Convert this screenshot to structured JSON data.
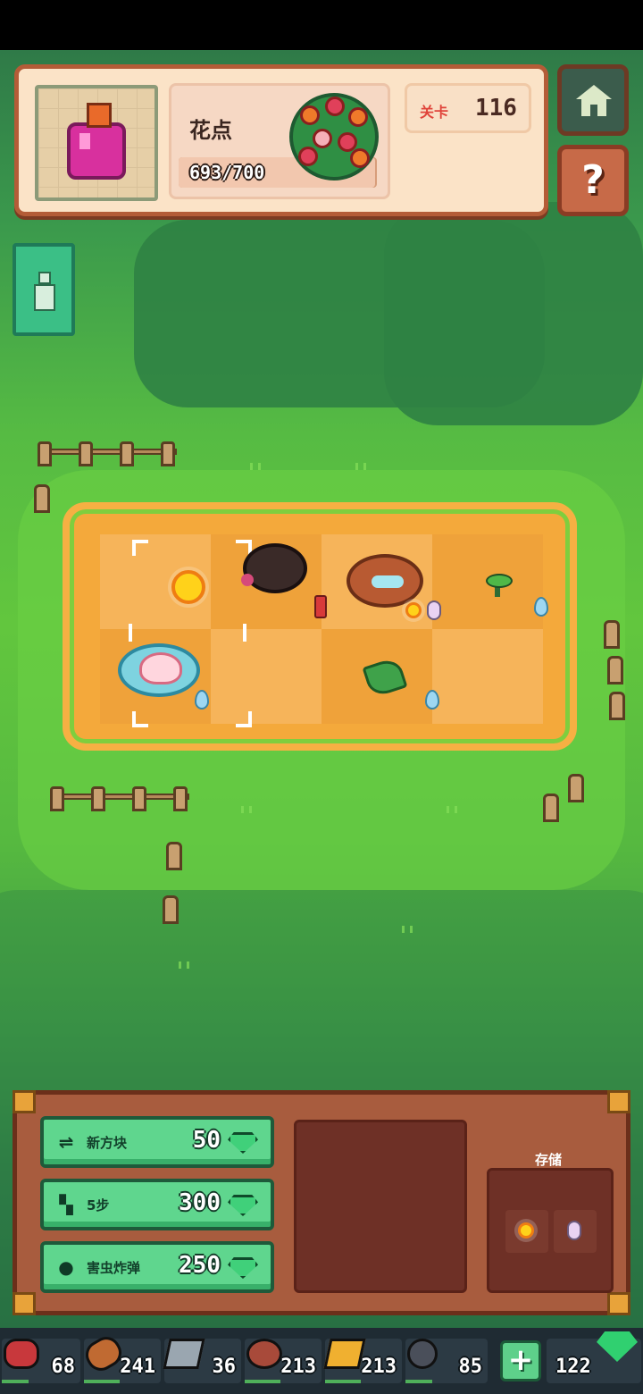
{
  "top_panel": {
    "flower_title": "花点",
    "progress_text": "693/700",
    "progress_value": 693,
    "progress_max": 700,
    "level_label": "关卡",
    "level_value": "116"
  },
  "buttons": {
    "home_icon": "home-icon",
    "help_label": "?"
  },
  "shop": {
    "items": [
      {
        "label": "新方块",
        "price": "50",
        "icon": "swap-icon"
      },
      {
        "label": "5步",
        "price": "300",
        "icon": "steps-icon"
      },
      {
        "label": "害虫炸弹",
        "price": "250",
        "icon": "bomb-icon"
      }
    ],
    "storage_label": "存储"
  },
  "resources": [
    {
      "name": "meat",
      "value": "68"
    },
    {
      "name": "wood",
      "value": "241"
    },
    {
      "name": "iron",
      "value": "36"
    },
    {
      "name": "fiber",
      "value": "213"
    },
    {
      "name": "gold",
      "value": "213"
    },
    {
      "name": "coal",
      "value": "85"
    },
    {
      "name": "gem",
      "value": "122"
    }
  ],
  "plus_label": "+",
  "colors": {
    "panel_border": "#b45c37",
    "board": "#f4a93b",
    "shop_button": "#5fd68e",
    "grass": "#56bb43"
  }
}
